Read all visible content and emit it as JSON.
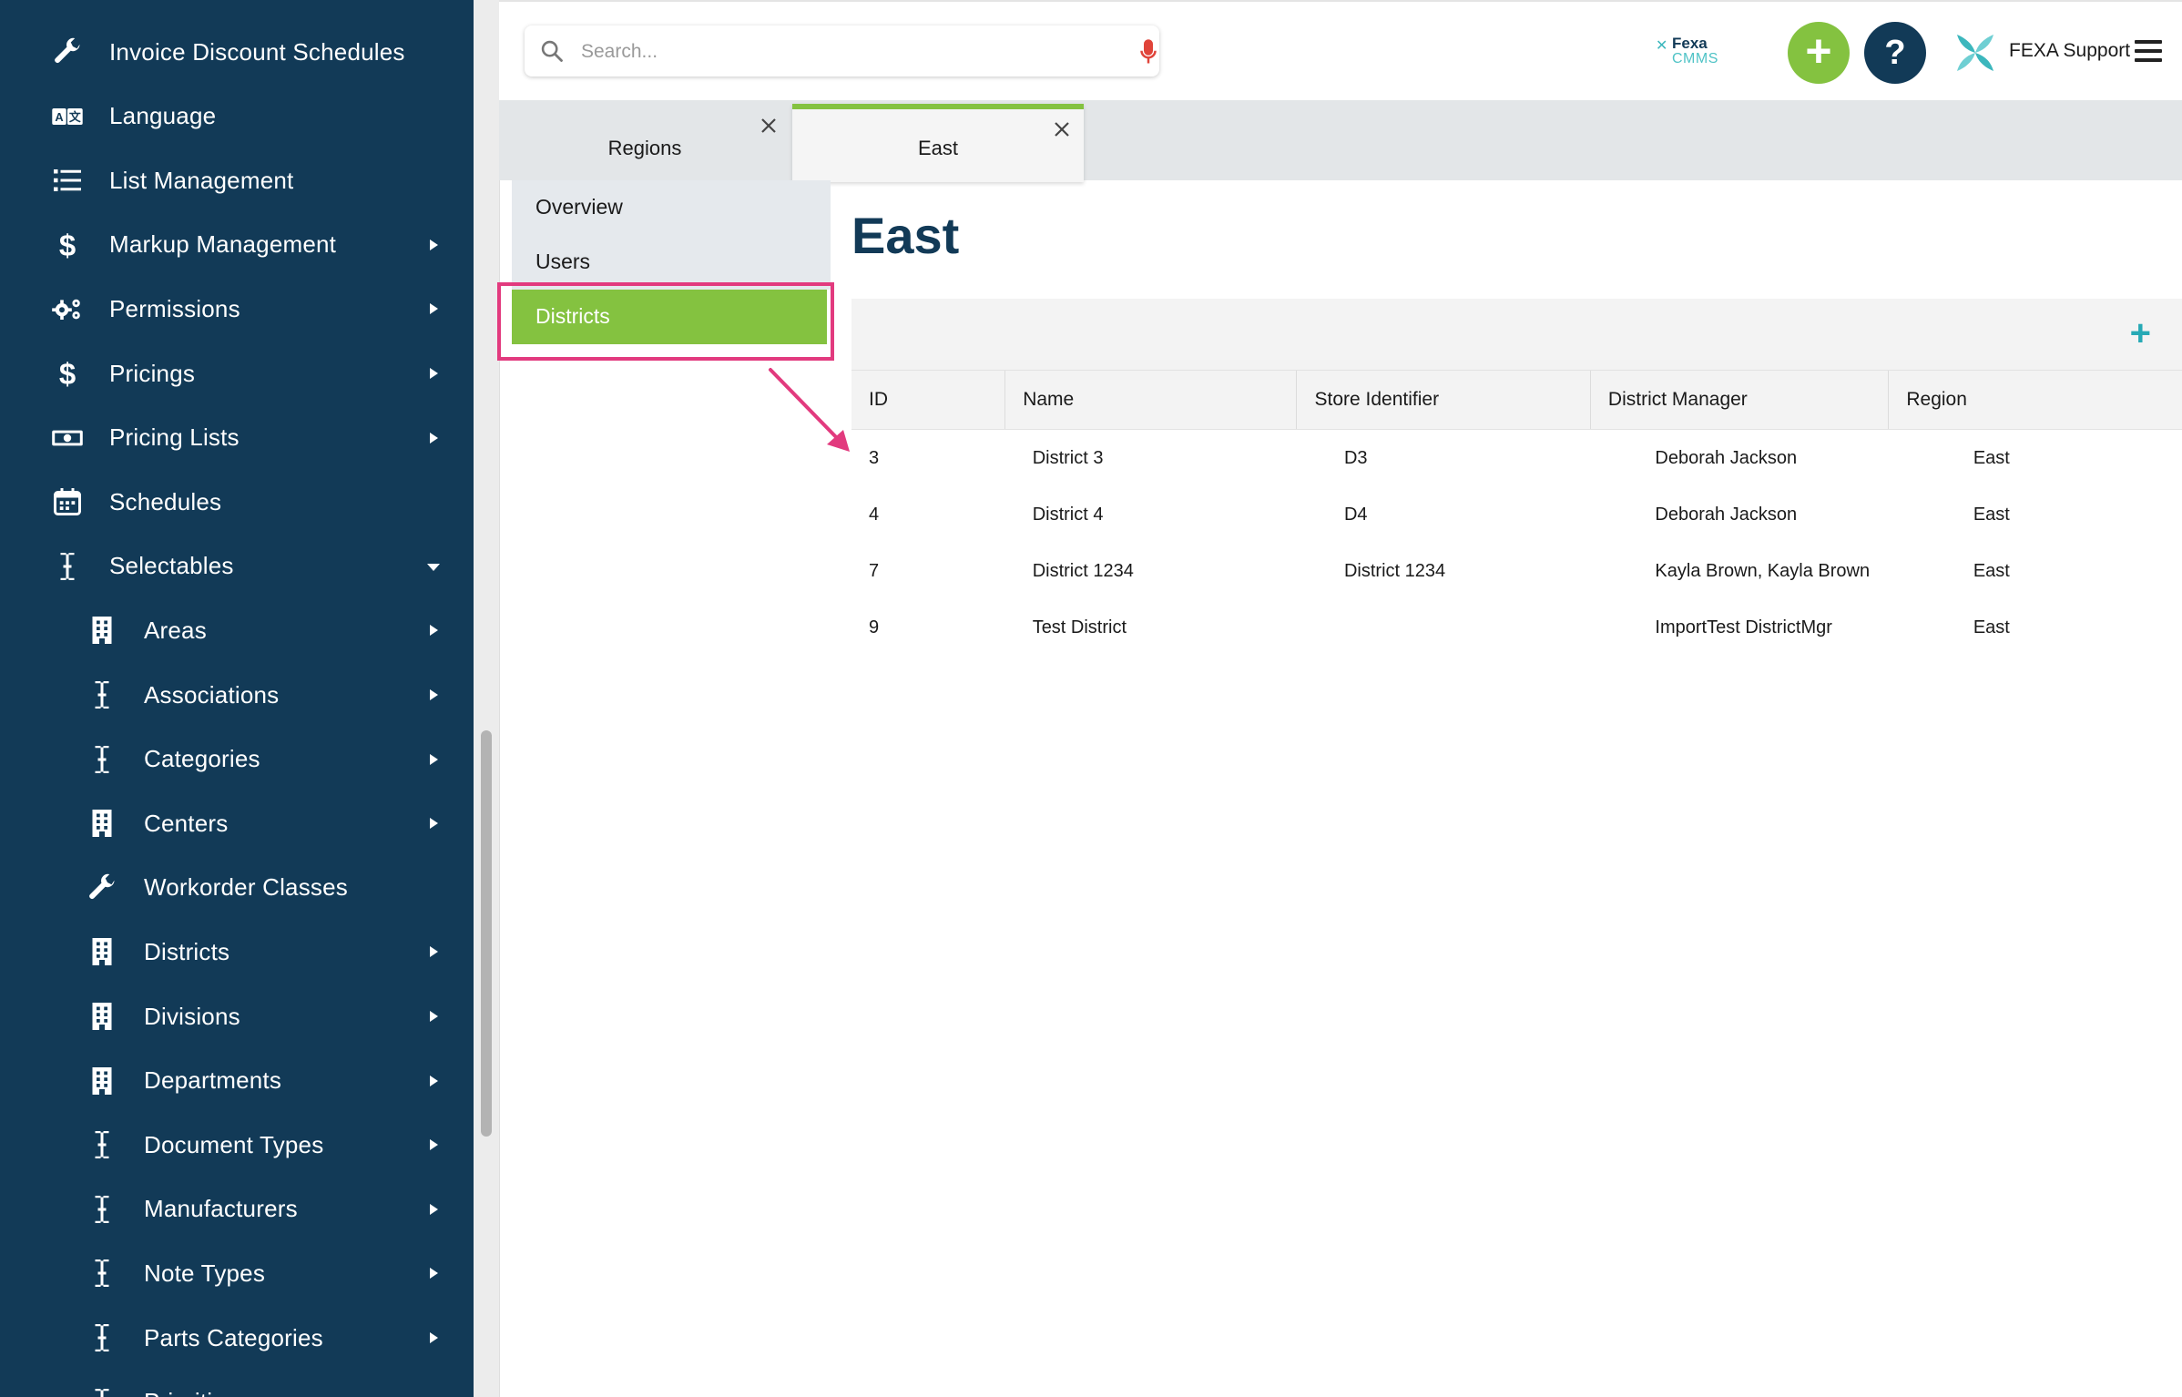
{
  "sidebar": {
    "items": [
      {
        "label": "Invoice Discount Schedules",
        "icon": "wrench-icon",
        "level": 1,
        "caret": "none"
      },
      {
        "label": "Language",
        "icon": "language-icon",
        "level": 1,
        "caret": "none"
      },
      {
        "label": "List Management",
        "icon": "list-icon",
        "level": 1,
        "caret": "none"
      },
      {
        "label": "Markup Management",
        "icon": "dollar-icon",
        "level": 1,
        "caret": "right"
      },
      {
        "label": "Permissions",
        "icon": "gears-icon",
        "level": 1,
        "caret": "right"
      },
      {
        "label": "Pricings",
        "icon": "dollar-icon",
        "level": 1,
        "caret": "right"
      },
      {
        "label": "Pricing Lists",
        "icon": "money-bill-icon",
        "level": 1,
        "caret": "right"
      },
      {
        "label": "Schedules",
        "icon": "calendar-icon",
        "level": 1,
        "caret": "none"
      },
      {
        "label": "Selectables",
        "icon": "text-cursor-icon",
        "level": 1,
        "caret": "down"
      },
      {
        "label": "Areas",
        "icon": "building-icon",
        "level": 2,
        "caret": "right"
      },
      {
        "label": "Associations",
        "icon": "text-cursor-icon",
        "level": 2,
        "caret": "right"
      },
      {
        "label": "Categories",
        "icon": "text-cursor-icon",
        "level": 2,
        "caret": "right"
      },
      {
        "label": "Centers",
        "icon": "building-icon",
        "level": 2,
        "caret": "right"
      },
      {
        "label": "Workorder Classes",
        "icon": "wrench-icon",
        "level": 2,
        "caret": "none"
      },
      {
        "label": "Districts",
        "icon": "building-icon",
        "level": 2,
        "caret": "right"
      },
      {
        "label": "Divisions",
        "icon": "building-icon",
        "level": 2,
        "caret": "right"
      },
      {
        "label": "Departments",
        "icon": "building-icon",
        "level": 2,
        "caret": "right"
      },
      {
        "label": "Document Types",
        "icon": "text-cursor-icon",
        "level": 2,
        "caret": "right"
      },
      {
        "label": "Manufacturers",
        "icon": "text-cursor-icon",
        "level": 2,
        "caret": "right"
      },
      {
        "label": "Note Types",
        "icon": "text-cursor-icon",
        "level": 2,
        "caret": "right"
      },
      {
        "label": "Parts Categories",
        "icon": "text-cursor-icon",
        "level": 2,
        "caret": "right"
      },
      {
        "label": "Priorities",
        "icon": "text-cursor-icon",
        "level": 2,
        "caret": "right"
      }
    ]
  },
  "header": {
    "search_placeholder": "Search...",
    "brand_line1": "Fexa",
    "brand_line2": "CMMS",
    "add_label": "+",
    "help_label": "?",
    "user_name": "FEXA Support"
  },
  "tabs": [
    {
      "label": "Regions",
      "active": false
    },
    {
      "label": "East",
      "active": true
    }
  ],
  "subnav": {
    "items": [
      {
        "label": "Overview",
        "selected": false
      },
      {
        "label": "Users",
        "selected": false
      },
      {
        "label": "Districts",
        "selected": true
      }
    ]
  },
  "main": {
    "title": "East",
    "add_label": "+",
    "table": {
      "columns": [
        "ID",
        "Name",
        "Store Identifier",
        "District Manager",
        "Region"
      ],
      "rows": [
        [
          "3",
          "District 3",
          "D3",
          "Deborah Jackson",
          "East"
        ],
        [
          "4",
          "District 4",
          "D4",
          "Deborah Jackson",
          "East"
        ],
        [
          "7",
          "District 1234",
          "District 1234",
          "Kayla Brown, Kayla Brown",
          "East"
        ],
        [
          "9",
          "Test District",
          "",
          "ImportTest DistrictMgr",
          "East"
        ]
      ]
    }
  },
  "colors": {
    "sidebar_bg": "#123a57",
    "accent_green": "#84c240",
    "title_navy": "#123a57",
    "annotation_pink": "#e23a7e",
    "add_teal": "#26a9b5"
  }
}
